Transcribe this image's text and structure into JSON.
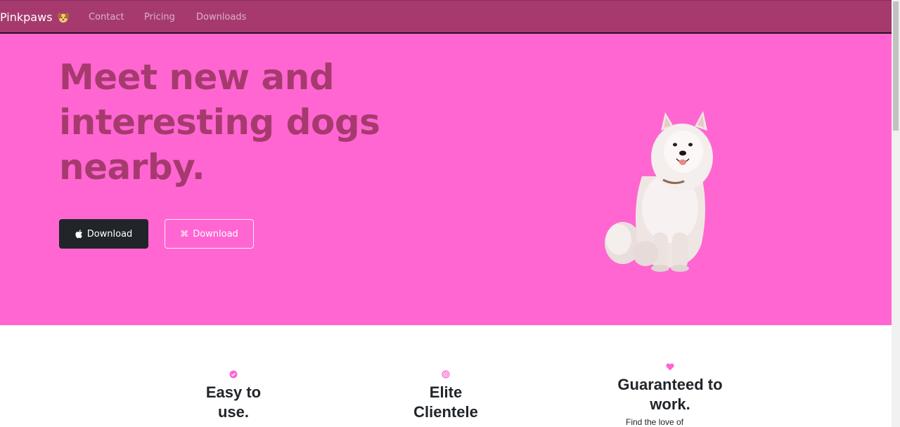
{
  "navbar": {
    "brand": "Pinkpaws",
    "brand_icon": "dog-face-icon",
    "links": [
      "Contact",
      "Pricing",
      "Downloads"
    ]
  },
  "hero": {
    "title": "Meet new and interesting dogs nearby.",
    "download_apple_label": "Download",
    "download_apple_icon": "apple-icon",
    "download_other_label": "Download",
    "download_other_icon": "command-icon",
    "image": "white-samoyed-dog"
  },
  "features": [
    {
      "title": "Easy to use.",
      "icon": "check-circle-icon"
    },
    {
      "title": "Elite Clientele",
      "icon": "bullseye-icon"
    },
    {
      "title": "Guaranteed to work.",
      "icon": "heart-icon",
      "text": "Find the love of"
    }
  ],
  "colors": {
    "navbar_bg": "#a63a6f",
    "hero_bg": "#ff66d1",
    "hero_title": "#a63a6f",
    "accent_icon": "#ff66d1",
    "dark_button": "#212529"
  }
}
